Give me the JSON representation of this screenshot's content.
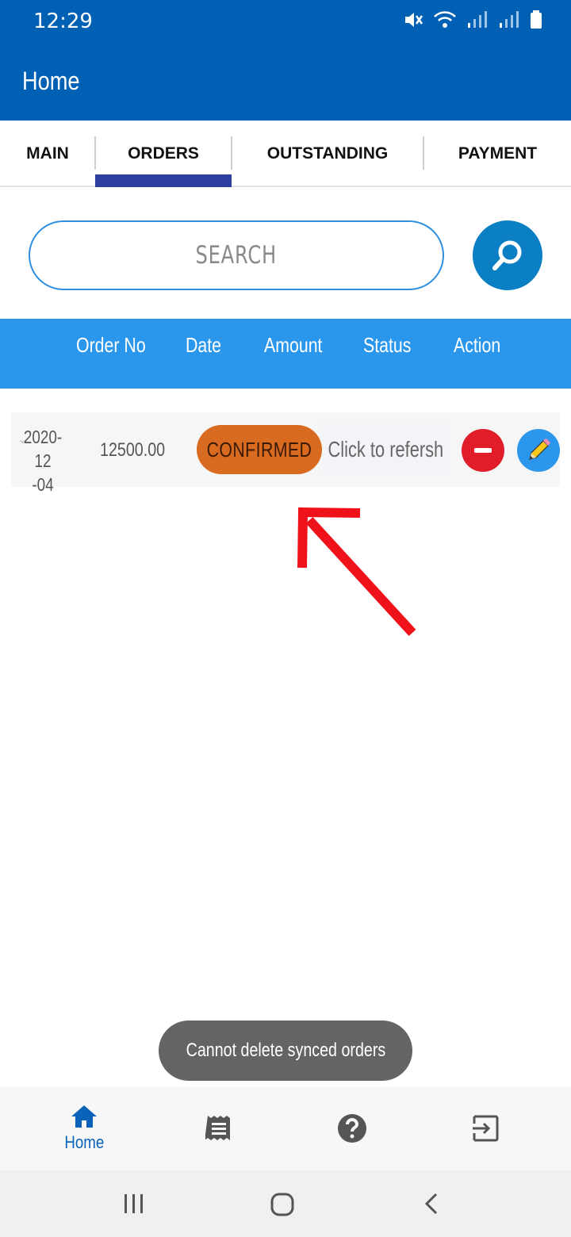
{
  "status_bar": {
    "time": "12:29"
  },
  "app_bar": {
    "title": "Home"
  },
  "tabs": [
    {
      "label": "MAIN"
    },
    {
      "label": "ORDERS"
    },
    {
      "label": "OUTSTANDING"
    },
    {
      "label": "PAYMENT"
    }
  ],
  "active_tab": "ORDERS",
  "search": {
    "placeholder": "SEARCH"
  },
  "table": {
    "columns": [
      "Order No",
      "Date",
      "Amount",
      "Status",
      "Action"
    ],
    "rows": [
      {
        "date_line1": "2020-12",
        "date_line2": "-04",
        "amount": "12500.00",
        "status": "CONFIRMED",
        "refresh_label": "Click to refersh"
      }
    ]
  },
  "toast": {
    "message": "Cannot delete synced orders"
  },
  "bottom_nav": {
    "items": [
      {
        "label": "Home",
        "icon": "home-icon"
      },
      {
        "label": "",
        "icon": "receipt-icon"
      },
      {
        "label": "",
        "icon": "help-icon"
      },
      {
        "label": "",
        "icon": "logout-icon"
      }
    ]
  },
  "colors": {
    "primary": "#0060b4",
    "table_header": "#2b97ec",
    "status_confirmed": "#d86b1f",
    "delete": "#e11d2a",
    "annotation_arrow": "#f0121a"
  }
}
